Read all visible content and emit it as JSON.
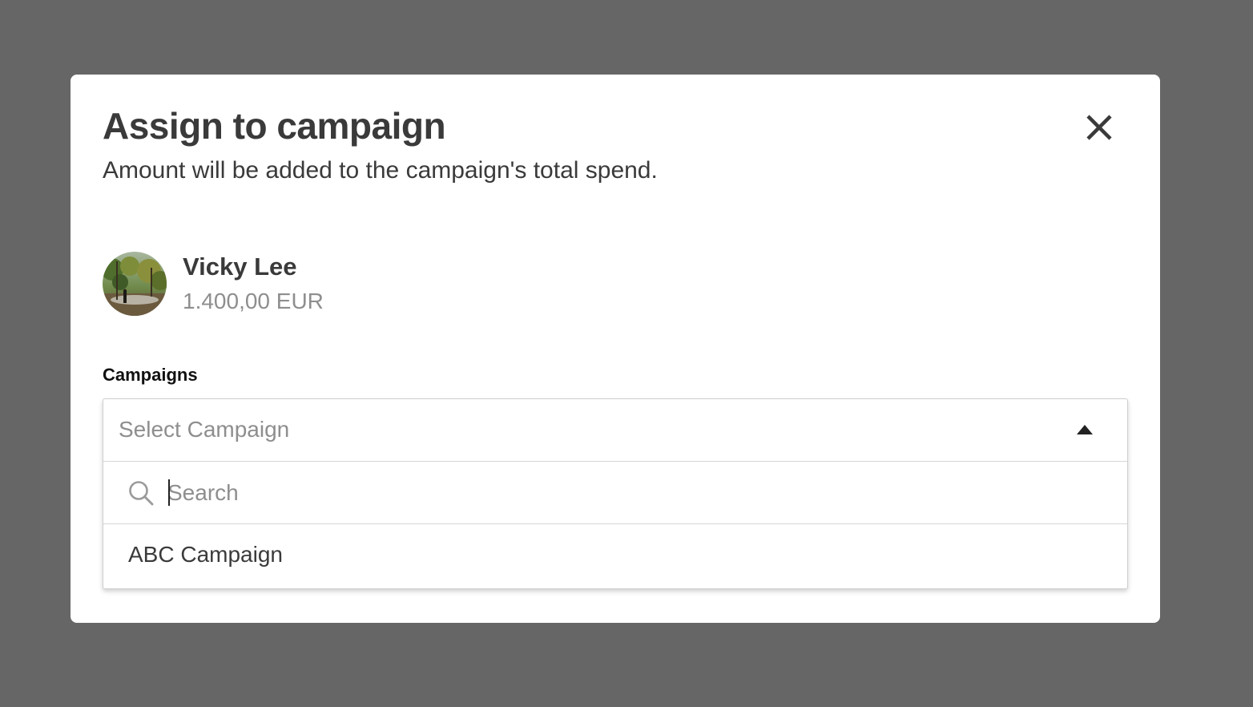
{
  "modal": {
    "title": "Assign to campaign",
    "subtitle": "Amount will be added to the campaign's total spend."
  },
  "creator": {
    "name": "Vicky Lee",
    "amount": "1.400,00 EUR"
  },
  "campaigns": {
    "label": "Campaigns",
    "placeholder": "Select Campaign",
    "search_placeholder": "Search",
    "search_value": "",
    "options": [
      "ABC Campaign"
    ]
  },
  "icons": {
    "close": "close-icon",
    "caret": "caret-up-icon",
    "search": "search-icon"
  },
  "colors": {
    "backdrop": "#666666",
    "modal_bg": "#ffffff",
    "text_primary": "#3a3a3a",
    "text_muted": "#8e8e8e",
    "border": "#cfcfcf"
  }
}
